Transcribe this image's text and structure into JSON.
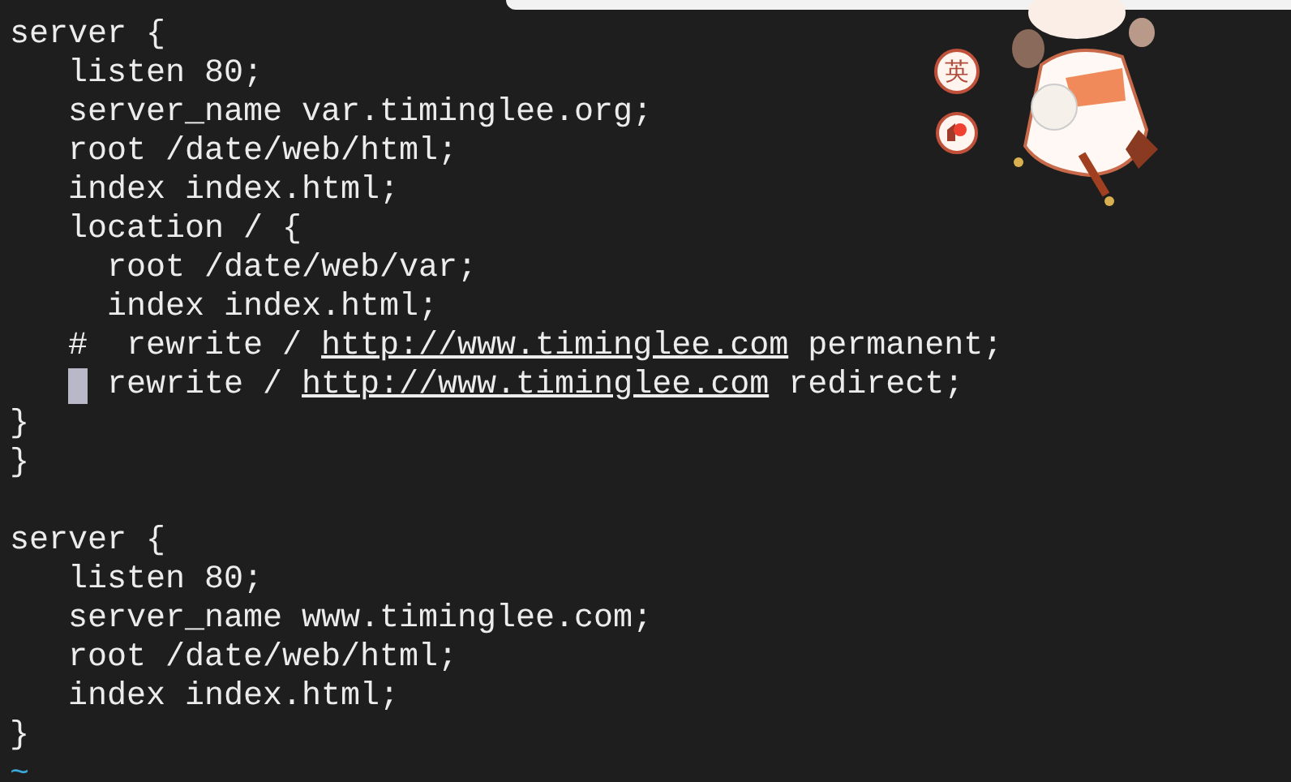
{
  "editor": {
    "lines": [
      [
        {
          "kind": "text",
          "text": "server {"
        }
      ],
      [
        {
          "kind": "text",
          "text": "   listen 80;"
        }
      ],
      [
        {
          "kind": "text",
          "text": "   server_name var.timinglee.org;"
        }
      ],
      [
        {
          "kind": "text",
          "text": "   root /date/web/html;"
        }
      ],
      [
        {
          "kind": "text",
          "text": "   index index.html;"
        }
      ],
      [
        {
          "kind": "text",
          "text": "   location / {"
        }
      ],
      [
        {
          "kind": "text",
          "text": "     root /date/web/var;"
        }
      ],
      [
        {
          "kind": "text",
          "text": "     index index.html;"
        }
      ],
      [
        {
          "kind": "text",
          "text": "   #  rewrite / "
        },
        {
          "kind": "link",
          "text": "http://www.timinglee.com"
        },
        {
          "kind": "text",
          "text": " permanent;"
        }
      ],
      [
        {
          "kind": "cursor"
        },
        {
          "kind": "text",
          "text": " rewrite / "
        },
        {
          "kind": "link",
          "text": "http://www.timinglee.com"
        },
        {
          "kind": "text",
          "text": " redirect;"
        }
      ],
      [
        {
          "kind": "text",
          "text": "}"
        }
      ],
      [
        {
          "kind": "text",
          "text": "}"
        }
      ],
      [
        {
          "kind": "blank"
        }
      ],
      [
        {
          "kind": "text",
          "text": "server {"
        }
      ],
      [
        {
          "kind": "text",
          "text": "   listen 80;"
        }
      ],
      [
        {
          "kind": "text",
          "text": "   server_name www.timinglee.com;"
        }
      ],
      [
        {
          "kind": "text",
          "text": "   root /date/web/html;"
        }
      ],
      [
        {
          "kind": "text",
          "text": "   index index.html;"
        }
      ],
      [
        {
          "kind": "text",
          "text": "}"
        }
      ],
      [
        {
          "kind": "tilde",
          "text": "~"
        }
      ]
    ]
  },
  "ime_toolbar": {
    "mode_label": "英"
  }
}
